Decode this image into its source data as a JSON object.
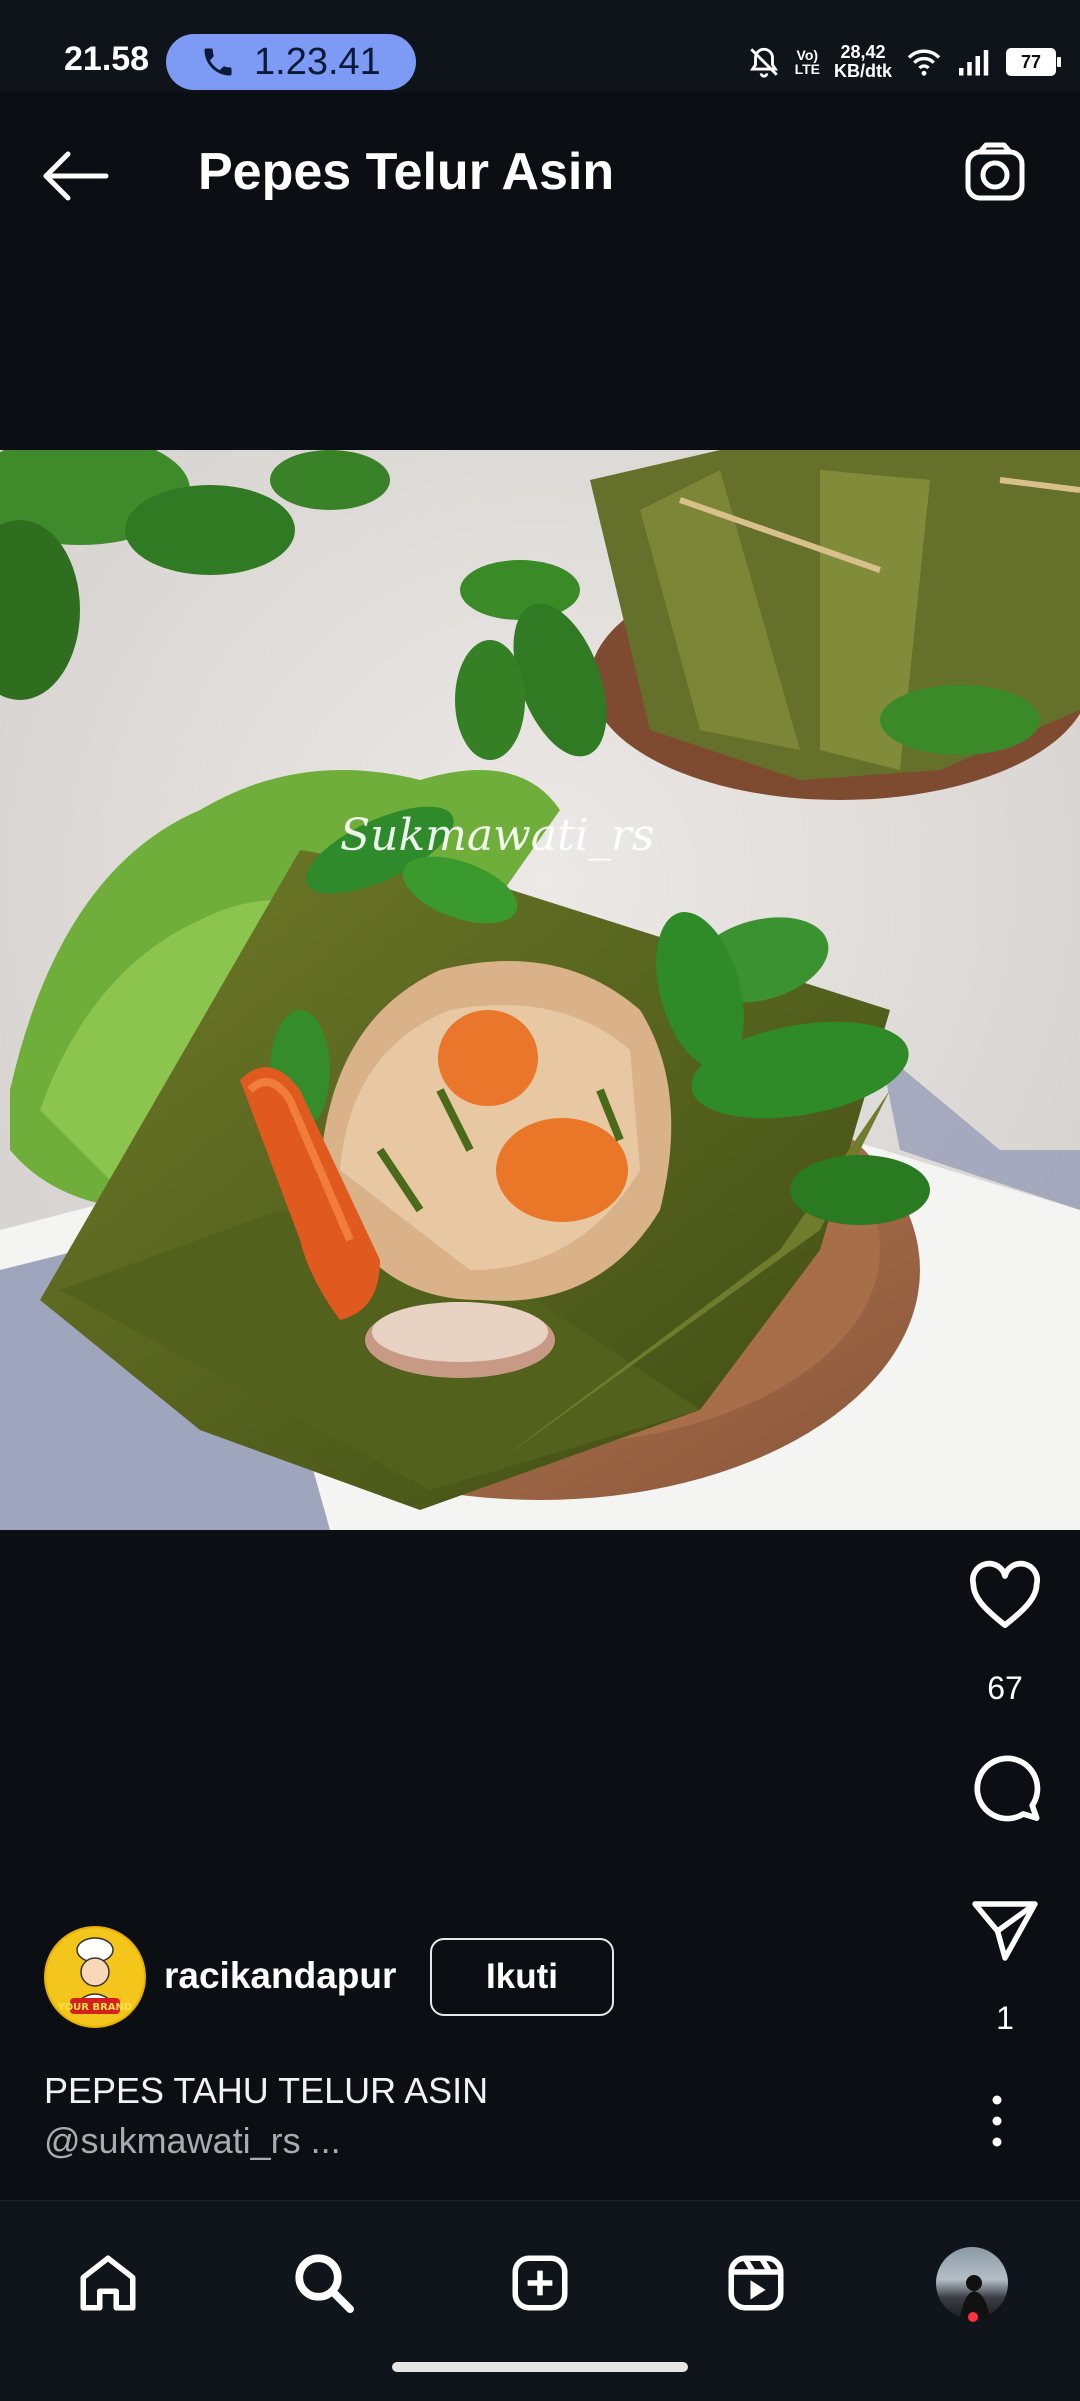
{
  "status_bar": {
    "time": "21.58",
    "call_timer": "1.23.41",
    "net_speed_value": "28,42",
    "net_speed_unit": "KB/dtk",
    "volte": "Vo)",
    "lte": "LTE",
    "battery": "77"
  },
  "header": {
    "title": "Pepes Telur Asin",
    "back_icon": "arrow-left-icon",
    "camera_icon": "camera-icon"
  },
  "post": {
    "watermark": "Sukmawati_rs",
    "likes": "67",
    "shares": "1"
  },
  "author": {
    "username": "racikandapur",
    "follow_label": "Ikuti",
    "logo_text": "YOUR BRAND"
  },
  "caption": {
    "title": "PEPES TAHU TELUR ASIN",
    "subtitle": "@sukmawati_rs ..."
  },
  "bottom_nav": {
    "items": [
      "home-icon",
      "search-icon",
      "create-post-icon",
      "reels-icon",
      "profile-avatar"
    ]
  }
}
